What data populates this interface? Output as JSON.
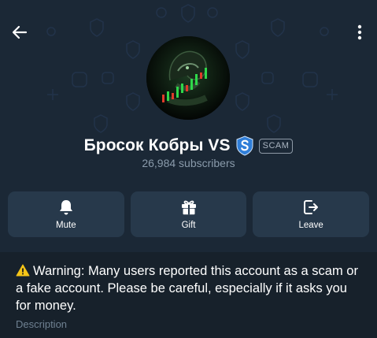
{
  "channel": {
    "title": "Бросок Кобры VS",
    "scam_label": "SCAM",
    "subscribers": "26,984 subscribers"
  },
  "actions": [
    {
      "label": "Mute",
      "icon": "bell-icon"
    },
    {
      "label": "Gift",
      "icon": "gift-icon"
    },
    {
      "label": "Leave",
      "icon": "leave-icon"
    }
  ],
  "info": {
    "warning": "Warning: Many users reported this account as a scam or a fake account. Please be careful, especially if it asks you for money.",
    "description_label": "Description"
  },
  "colors": {
    "background": "#17212b",
    "header": "#1b2836",
    "button": "#27394b",
    "badge_blue": "#2f7ed8",
    "warning_yellow": "#f5c518"
  }
}
